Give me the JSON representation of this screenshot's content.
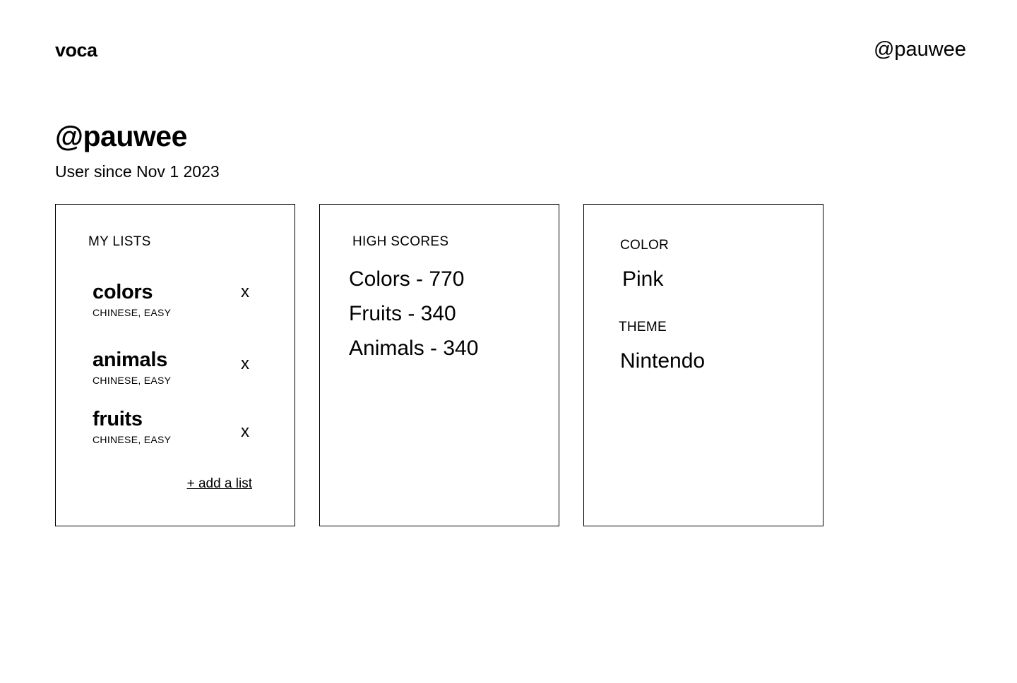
{
  "header": {
    "logo": "voca",
    "user": "@pauwee"
  },
  "profile": {
    "username": "@pauwee",
    "since": "User since Nov 1 2023"
  },
  "lists": {
    "label": "MY LISTS",
    "items": [
      {
        "name": "colors",
        "meta": "CHINESE, EASY",
        "delete": "x"
      },
      {
        "name": "animals",
        "meta": "CHINESE, EASY",
        "delete": "x"
      },
      {
        "name": "fruits",
        "meta": "CHINESE, EASY",
        "delete": "x"
      }
    ],
    "add": "+ add a list"
  },
  "scores": {
    "label": "HIGH SCORES",
    "items": [
      "Colors - 770",
      "Fruits - 340",
      "Animals - 340"
    ]
  },
  "prefs": {
    "color_label": "COLOR",
    "color_value": "Pink",
    "theme_label": "THEME",
    "theme_value": "Nintendo"
  }
}
